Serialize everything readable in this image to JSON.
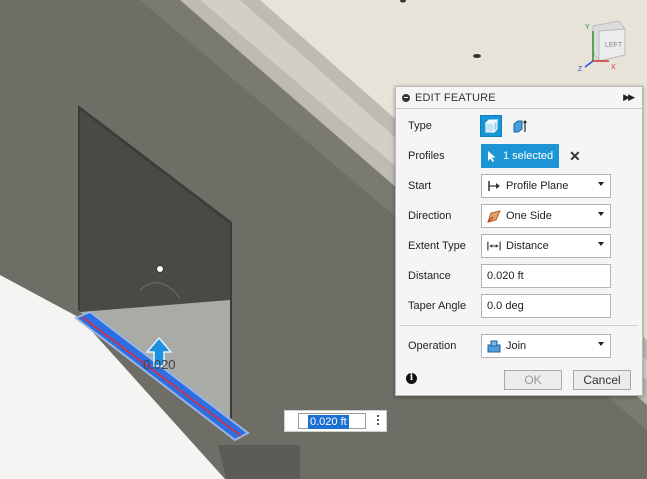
{
  "panel": {
    "title": "EDIT FEATURE",
    "rows": {
      "type": {
        "label": "Type"
      },
      "profiles": {
        "label": "Profiles",
        "button": "1 selected"
      },
      "start": {
        "label": "Start",
        "value": "Profile Plane"
      },
      "direction": {
        "label": "Direction",
        "value": "One Side"
      },
      "extent_type": {
        "label": "Extent Type",
        "value": "Distance"
      },
      "distance": {
        "label": "Distance",
        "value": "0.020 ft"
      },
      "taper_angle": {
        "label": "Taper Angle",
        "value": "0.0 deg"
      },
      "operation": {
        "label": "Operation",
        "value": "Join"
      }
    },
    "ok": "OK",
    "cancel": "Cancel"
  },
  "manipulator": {
    "distance_value": "0.020 ft",
    "dimension_label": "0.020"
  },
  "viewcube": {
    "face": "LEFT",
    "axes": {
      "x": "X",
      "y": "Y",
      "z": "Z"
    }
  },
  "colors": {
    "accent": "#1d95d5",
    "selection": "#2c6fe0",
    "highlight_edge": "#e2293a"
  }
}
